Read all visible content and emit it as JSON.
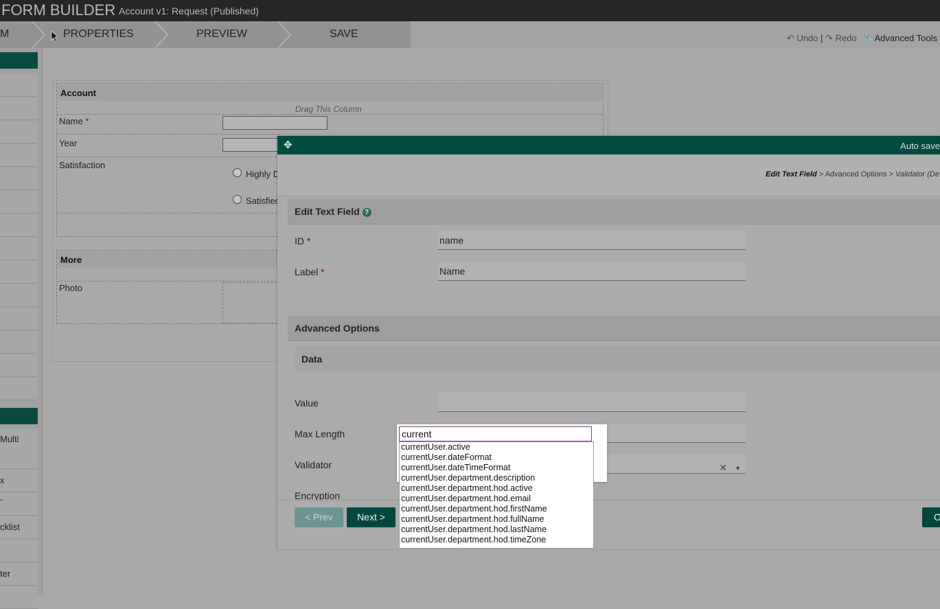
{
  "header": {
    "title": "FORM BUILDER",
    "subtitle": "Account v1: Request (Published)"
  },
  "steps": {
    "partial_first": "M",
    "properties": "PROPERTIES",
    "preview": "PREVIEW",
    "save": "SAVE"
  },
  "tools": {
    "undo": "Undo",
    "separator": "|",
    "redo": "Redo",
    "advanced": "Advanced Tools"
  },
  "sidebar": {
    "labels": [
      "Multi",
      "x",
      "-",
      "cklist",
      "ter"
    ]
  },
  "canvas": {
    "drag_hint": "Drag This Column",
    "section1_title": "Account",
    "name_label": "Name",
    "required_mark": "*",
    "year_label": "Year",
    "satisfaction_label": "Satisfaction",
    "radio1": "Highly D",
    "radio2": "Satisfied",
    "section2_title": "More",
    "photo_label": "Photo"
  },
  "dialog": {
    "autosave": "Auto save",
    "crumb_current": "Edit Text Field",
    "crumb_sep1": ">",
    "crumb_mid": "Advanced Options",
    "crumb_sep2": ">",
    "crumb_last": "Validator (De",
    "edit_title": "Edit Text Field",
    "id_label": "ID",
    "id_value": "name",
    "label_label": "Label",
    "label_value": "Name",
    "advanced_title": "Advanced Options",
    "data_title": "Data",
    "value_label": "Value",
    "value_value": "",
    "maxlength_label": "Max Length",
    "validator_label": "Validator",
    "encryption_label": "Encryption",
    "prev_button": "< Prev",
    "next_button": "Next >",
    "ok_button": "O"
  },
  "autocomplete": {
    "query": "current",
    "options": [
      "currentUser.active",
      "currentUser.dateFormat",
      "currentUser.dateTimeFormat",
      "currentUser.department.description",
      "currentUser.department.hod.active",
      "currentUser.department.hod.email",
      "currentUser.department.hod.firstName",
      "currentUser.department.hod.fullName",
      "currentUser.department.hod.lastName",
      "currentUser.department.hod.timeZone"
    ]
  },
  "colors": {
    "accent": "#004a40",
    "topbar": "#262626",
    "overlay_gray": "#a9a9a9",
    "required": "#8b0000",
    "focus_purple": "#7a3b85"
  }
}
